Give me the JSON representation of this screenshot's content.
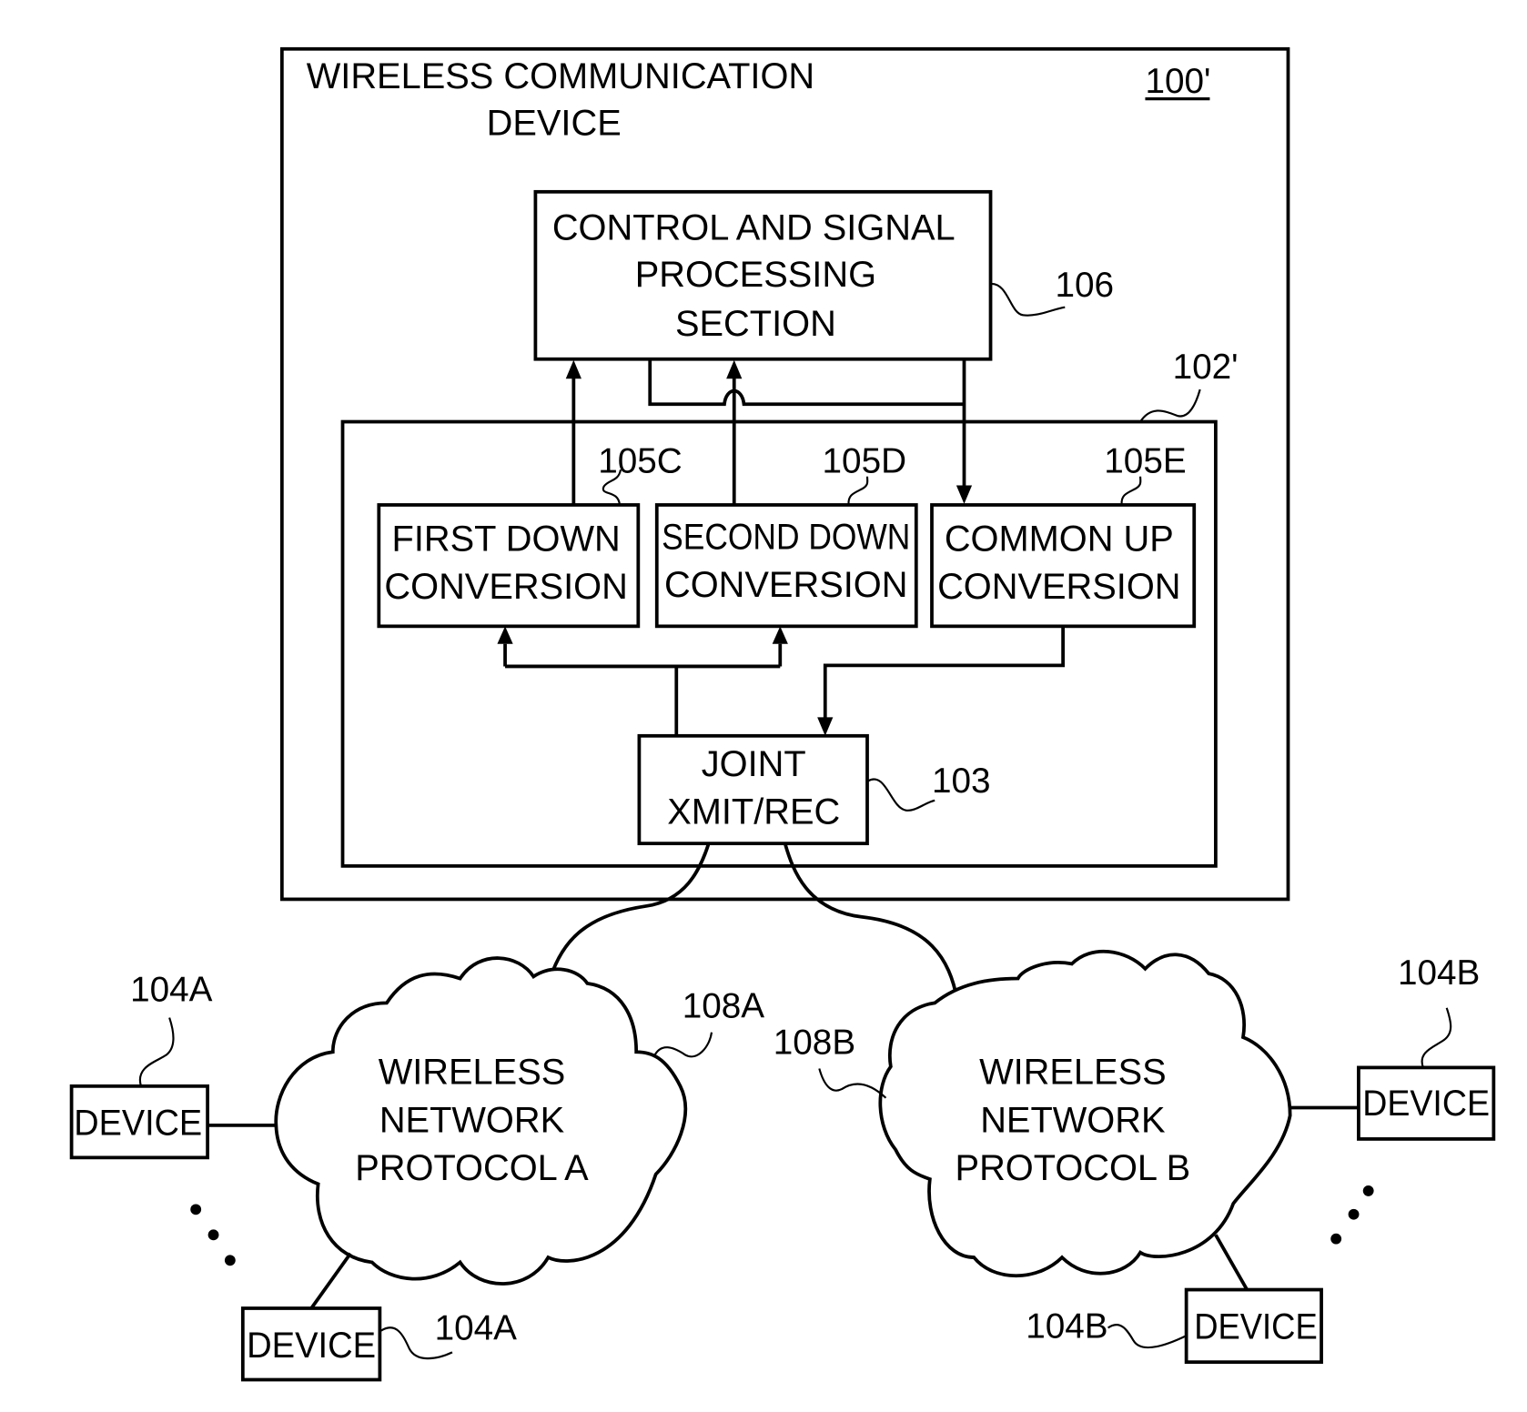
{
  "figure": {
    "device": {
      "title_line1": "WIRELESS COMMUNICATION",
      "title_line2": "DEVICE",
      "ref": "100'"
    },
    "control_section": {
      "lines": [
        "CONTROL AND SIGNAL",
        "PROCESSING",
        "SECTION"
      ],
      "ref": "106"
    },
    "transceiver_module": {
      "ref": "102'"
    },
    "blocks": [
      {
        "id": "first_down",
        "lines": [
          "FIRST DOWN",
          "CONVERSION"
        ],
        "ref": "105C"
      },
      {
        "id": "second_down",
        "lines": [
          "SECOND DOWN",
          "CONVERSION"
        ],
        "ref": "105D"
      },
      {
        "id": "common_up",
        "lines": [
          "COMMON UP",
          "CONVERSION"
        ],
        "ref": "105E"
      }
    ],
    "joint": {
      "lines": [
        "JOINT",
        "XMIT/REC"
      ],
      "ref": "103"
    },
    "networks": [
      {
        "id": "A",
        "lines": [
          "WIRELESS",
          "NETWORK",
          "PROTOCOL A"
        ],
        "ref": "108A"
      },
      {
        "id": "B",
        "lines": [
          "WIRELESS",
          "NETWORK",
          "PROTOCOL B"
        ],
        "ref": "108B"
      }
    ],
    "devices": [
      {
        "label": "DEVICE",
        "ref": "104A"
      },
      {
        "label": "DEVICE",
        "ref": "104A"
      },
      {
        "label": "DEVICE",
        "ref": "104B"
      },
      {
        "label": "DEVICE",
        "ref": "104B"
      }
    ]
  }
}
